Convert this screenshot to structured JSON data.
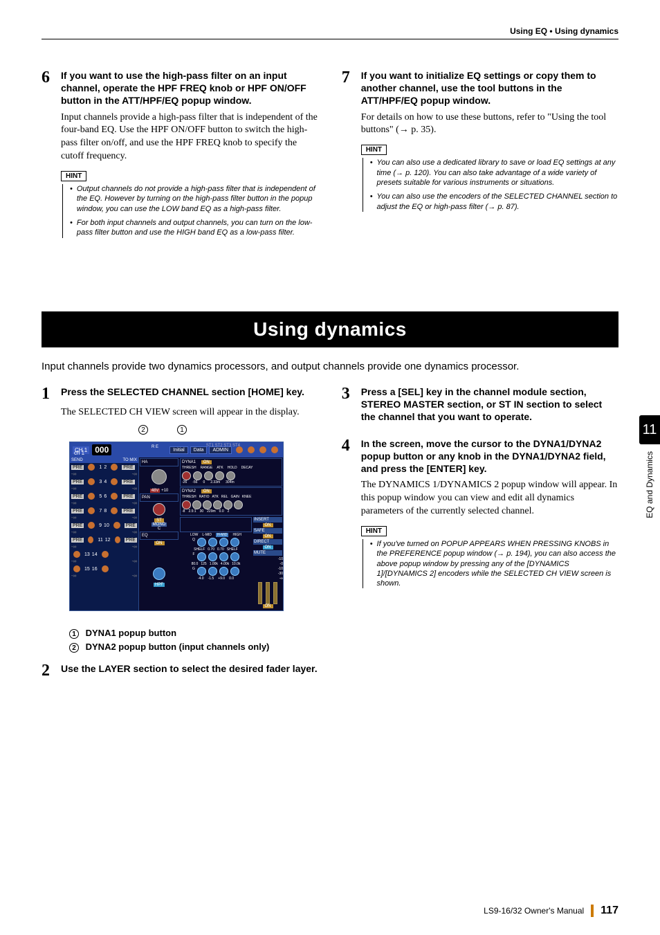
{
  "header": {
    "breadcrumb": "Using EQ • Using dynamics"
  },
  "upper": {
    "left": {
      "num": "6",
      "title": "If you want to use the high-pass filter on an input channel, operate the HPF FREQ knob or HPF ON/OFF button in the ATT/HPF/EQ popup window.",
      "body": "Input channels provide a high-pass filter that is independent of the four-band EQ. Use the HPF ON/OFF button to switch the high-pass filter on/off, and use the HPF FREQ knob to specify the cutoff frequency.",
      "hint_label": "HINT",
      "hints": [
        "Output channels do not provide a high-pass filter that is independent of the EQ. However by turning on the high-pass filter button in the popup window, you can use the LOW band EQ as a high-pass filter.",
        "For both input channels and output channels, you can turn on the low-pass filter button and use the HIGH band EQ as a low-pass filter."
      ]
    },
    "right": {
      "num": "7",
      "title": "If you want to initialize EQ settings or copy them to another channel, use the tool buttons in the ATT/HPF/EQ popup window.",
      "body": "For details on how to use these buttons, refer to \"Using the tool buttons\" (→ p. 35).",
      "hint_label": "HINT",
      "hints": [
        "You can also use a dedicated library to save or load EQ settings at any time (→ p. 120). You can also take advantage of a wide variety of presets suitable for various instruments or situations.",
        "You can also use the encoders of the SELECTED CHANNEL section to adjust the EQ or high-pass filter (→ p. 87)."
      ]
    }
  },
  "section_heading": "Using dynamics",
  "intro": "Input channels provide two dynamics processors, and output channels provide one dynamics processor.",
  "side_tab": {
    "number": "11",
    "text": "EQ and Dynamics"
  },
  "lower": {
    "left": {
      "s1_num": "1",
      "s1_title": "Press the SELECTED CHANNEL section [HOME] key.",
      "s1_body": "The SELECTED CH VIEW screen will appear in the display.",
      "callout1_num": "1",
      "callout1": "DYNA1 popup button",
      "callout2_num": "2",
      "callout2": "DYNA2 popup button (input channels only)",
      "s2_num": "2",
      "s2_title": "Use the LAYER section to select the desired fader layer."
    },
    "right": {
      "s3_num": "3",
      "s3_title": "Press a [SEL] key in the channel module section, STEREO MASTER section, or ST IN section to select the channel that you want to operate.",
      "s4_num": "4",
      "s4_title": "In the screen, move the cursor to the DYNA1/DYNA2 popup button or any knob in the DYNA1/DYNA2 field, and press the [ENTER] key.",
      "s4_body": "The DYNAMICS 1/DYNAMICS 2 popup window will appear. In this popup window you can view and edit all dynamics parameters of the currently selected channel.",
      "hint_label": "HINT",
      "hints": [
        "If you've turned on POPUP APPEARS WHEN PRESSING KNOBS in the PREFERENCE popup window (→ p. 194), you can also access the above popup window by pressing any of the [DYNAMICS 1]/[DYNAMICS 2] encoders while the SELECTED CH VIEW screen is shown."
      ]
    }
  },
  "screenshot": {
    "ch_label_top": "CH 1",
    "ch_label_bot": "ch 1",
    "counter": "000",
    "initial": "Initial",
    "data": "Data",
    "admin": "ADMIN",
    "send": "SEND",
    "tomix": "TO MIX",
    "ha": "HA",
    "dyna1": "DYNA1",
    "on": "ON",
    "thresh": "THRESH",
    "range": "RANGE",
    "atk": "ATK",
    "hold": "HOLD",
    "decay": "DECAY",
    "d1_v1": "-26",
    "d1_v2": "-56",
    "d1_v3": "0",
    "d1_v4": "2.33m",
    "d1_v5": "304m",
    "dyna2": "DYNA2",
    "ratio": "RATIO",
    "rel": "REL",
    "gain": "GAIN",
    "knee": "KNEE",
    "d2_v1": "-8",
    "d2_v2": "2.5:1",
    "d2_v3": "30",
    "d2_v4": "229m",
    "d2_v5": "0.0",
    "d2_v6": "2",
    "pan": "PAN",
    "st": "ST",
    "mono": "MONO",
    "p48": "48V",
    "plus10": "+10",
    "eq": "EQ",
    "hpf": "HPF",
    "insert": "INSERT",
    "safe": "SAFE",
    "direct": "DIRECT",
    "mute": "MUTE",
    "low": "LOW",
    "lmid": "L-MID",
    "hmid": "H-MID",
    "high": "HIGH",
    "shelf": "SHELF",
    "q": "Q",
    "f": "F",
    "g": "G",
    "eq_q1": "SHELF",
    "eq_q2": "0.70",
    "eq_q3": "0.70",
    "eq_q4": "SHELF",
    "eq_f1": "80.0",
    "eq_f2": "125",
    "eq_f3": "1.00k",
    "eq_f4": "4.00k",
    "eq_f5": "10.0k",
    "eq_g1": "-4.0",
    "eq_g2": "-1.5",
    "eq_g3": "+9.0",
    "eq_g4": "0.0",
    "scale": [
      "-10",
      "-0",
      "-10",
      "-30",
      "-∞"
    ],
    "pre": "PRE",
    "st1": "ST1",
    "st2": "ST2",
    "st3": "ST3",
    "st4": "ST4",
    "inf": "-∞",
    "re": "R E",
    "nums": [
      "1",
      "2",
      "3",
      "4",
      "5",
      "6",
      "7",
      "8",
      "9",
      "10",
      "11",
      "12",
      "13",
      "14",
      "15",
      "16"
    ]
  },
  "footer": {
    "manual": "LS9-16/32  Owner's Manual",
    "page": "117"
  }
}
